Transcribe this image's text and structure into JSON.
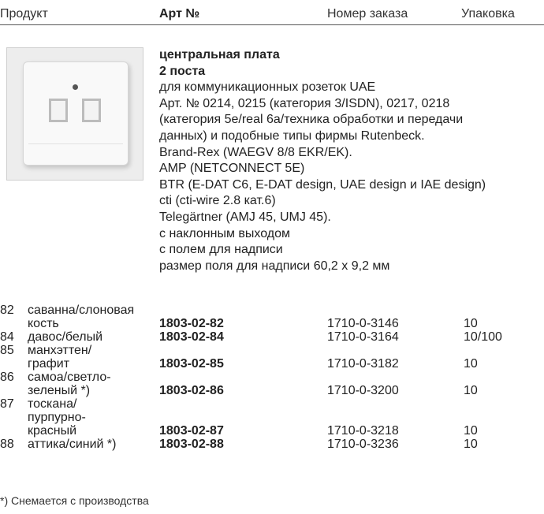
{
  "header": {
    "product": "Продукт",
    "art_no": "Арт №",
    "order_no": "Номер заказа",
    "package": "Упаковка"
  },
  "image": {
    "description_icon": "wall-plate-icon"
  },
  "description": {
    "title": "центральная плата",
    "subtitle": "2 поста",
    "lines": [
      "для коммуникационных розеток UAE",
      "Арт. № 0214, 0215 (категория 3/ISDN), 0217, 0218",
      "(категория 5e/real 6a/техника обработки и передачи",
      "данных) и подобные типы фирмы Rutenbeck.",
      "Brand-Rex (WAEGV 8/8 EKR/EK).",
      "AMP (NETCONNECT 5E)",
      "BTR (E-DAT C6, E-DAT design, UAE design и IAE design)",
      "cti (cti-wire 2.8 кат.6)",
      "Telegärtner (AMJ 45, UMJ 45).",
      "с наклонным выходом",
      "с полем для надписи",
      "размер поля для надписи 60,2 x 9,2 мм"
    ]
  },
  "rows": [
    {
      "num": "82",
      "name_lines": [
        "саванна/слоновая",
        "кость"
      ],
      "art": "1803-02-82",
      "order": "1710-0-3146",
      "pack": "10"
    },
    {
      "num": "84",
      "name_lines": [
        "давос/белый"
      ],
      "art": "1803-02-84",
      "order": "1710-0-3164",
      "pack": "10/100"
    },
    {
      "num": "85",
      "name_lines": [
        "манхэттен/",
        "графит"
      ],
      "art": "1803-02-85",
      "order": "1710-0-3182",
      "pack": "10"
    },
    {
      "num": "86",
      "name_lines": [
        "самоа/светло-",
        "зеленый *)"
      ],
      "art": "1803-02-86",
      "order": "1710-0-3200",
      "pack": "10"
    },
    {
      "num": "87",
      "name_lines": [
        "тоскана/",
        "пурпурно-",
        "красный"
      ],
      "art": "1803-02-87",
      "order": "1710-0-3218",
      "pack": "10"
    },
    {
      "num": "88",
      "name_lines": [
        "аттика/синий *)"
      ],
      "art": "1803-02-88",
      "order": "1710-0-3236",
      "pack": "10"
    }
  ],
  "footnote": "*) Снемается с производства"
}
